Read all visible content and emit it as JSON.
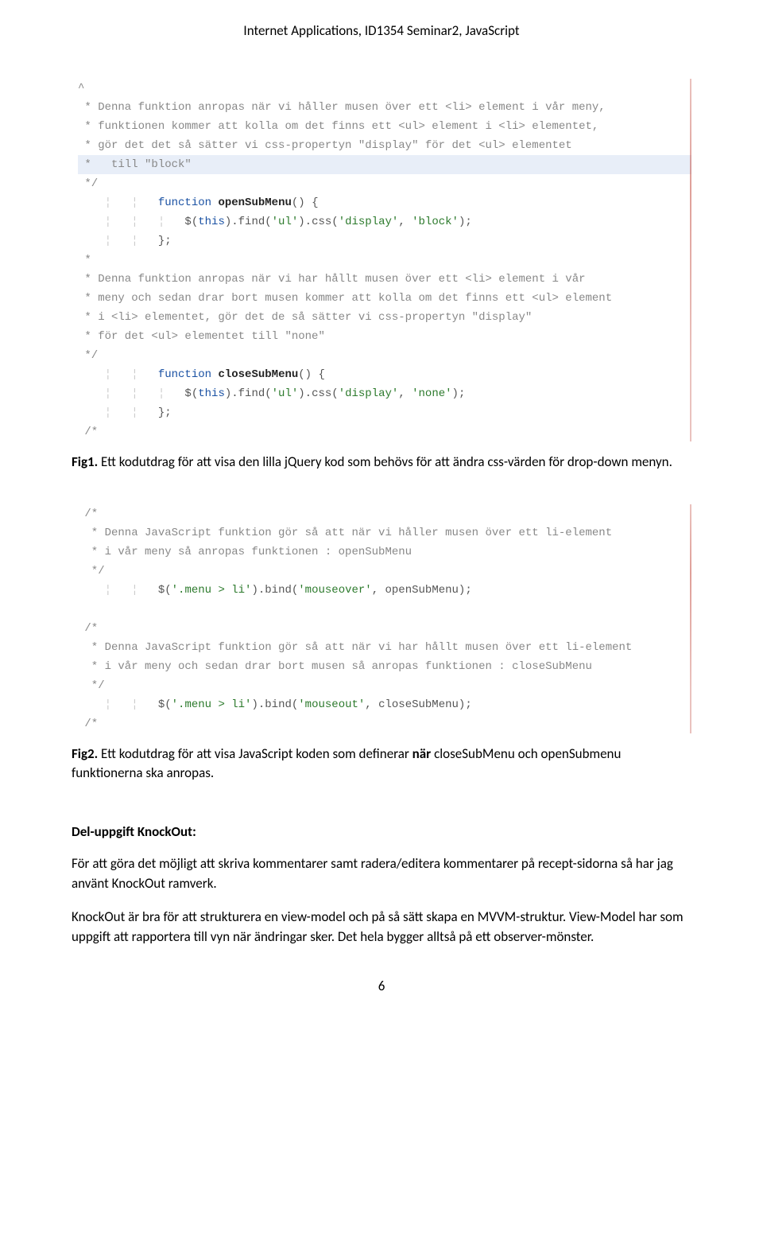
{
  "header": "Internet Applications, ID1354 Seminar2, JavaScript",
  "code1": {
    "l1": "^",
    "c1": " * Denna funktion anropas när vi håller musen över ett <li> element i vår meny,",
    "c2": " * funktionen kommer att kolla om det finns ett <ul> element i <li> elementet,",
    "c3": " * gör det det så sätter vi css-propertyn \"display\" för det <ul> elementet",
    "c4": " *   till \"block\"",
    "c5": " */",
    "fn1a": "function",
    "fn1b": "openSubMenu",
    "fn1c": "() {",
    "body1a": "$(",
    "body1b": "this",
    "body1c": ").find(",
    "body1d": "'ul'",
    "body1e": ").css(",
    "body1f": "'display'",
    "body1g": ", ",
    "body1h": "'block'",
    "body1i": ");",
    "close1": "};",
    "c6": " *",
    "c7": " * Denna funktion anropas när vi har hållt musen över ett <li> element i vår",
    "c8": " * meny och sedan drar bort musen kommer att kolla om det finns ett <ul> element",
    "c9": " * i <li> elementet, gör det de så sätter vi css-propertyn \"display\"",
    "c10": " * för det <ul> elementet till \"none\"",
    "c11": " */",
    "fn2a": "function",
    "fn2b": "closeSubMenu",
    "fn2c": "() {",
    "body2d": "'ul'",
    "body2f": "'display'",
    "body2h": "'none'",
    "close2": "};"
  },
  "caption1a": "Fig1.",
  "caption1b": " Ett kodutdrag för att visa den lilla jQuery kod som behövs för att ändra css-värden för drop-down menyn.",
  "code2": {
    "c1": " /*",
    "c2": "  * Denna JavaScript funktion gör så att när vi håller musen över ett li-element",
    "c3": "  * i vår meny så anropas funktionen : openSubMenu",
    "c4": "  */",
    "b1a": "$(",
    "b1b": "'.menu > li'",
    "b1c": ").bind(",
    "b1d": "'mouseover'",
    "b1e": ", openSubMenu);",
    "c5": " /*",
    "c6": "  * Denna JavaScript funktion gör så att när vi har hållt musen över ett li-element",
    "c7": "  * i vår meny och sedan drar bort musen så anropas funktionen : closeSubMenu",
    "c8": "  */",
    "b2b": "'.menu > li'",
    "b2d": "'mouseout'",
    "b2e": ", closeSubMenu);"
  },
  "caption2a": "Fig2.",
  "caption2b": " Ett kodutdrag för att visa JavaScript koden som definerar ",
  "caption2c": "när",
  "caption2d": " closeSubMenu och openSubmenu funktionerna ska anropas.",
  "section": "Del-uppgift KnockOut:",
  "para1": "För att göra det möjligt att skriva kommentarer samt radera/editera kommentarer på recept-sidorna så har jag använt KnockOut ramverk.",
  "para2": "KnockOut är bra för att strukturera en view-model och på så sätt skapa en MVVM-struktur. View-Model har som uppgift att rapportera till vyn när ändringar sker. Det hela bygger alltså på ett observer-mönster.",
  "pagenum": "6"
}
